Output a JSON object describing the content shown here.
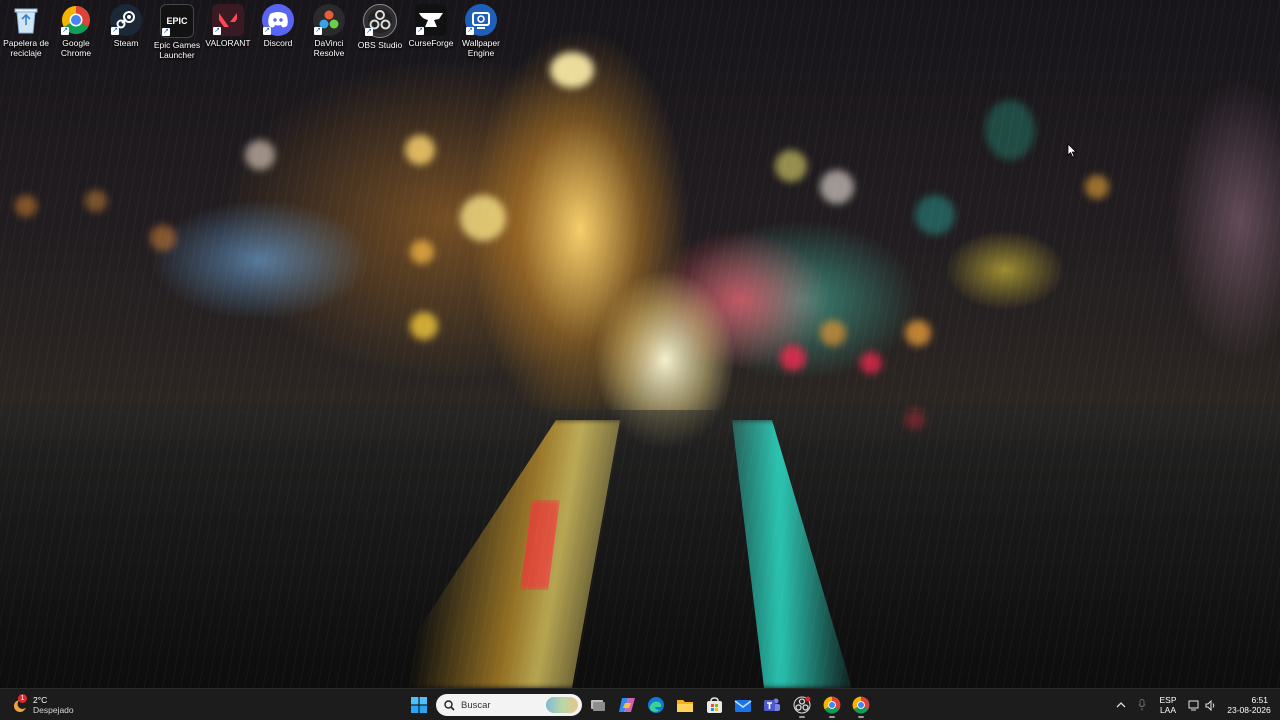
{
  "desktop": {
    "icons": [
      {
        "label": "Papelera de reciclaje",
        "icon": "recycle-bin-icon"
      },
      {
        "label": "Google Chrome",
        "icon": "chrome-icon"
      },
      {
        "label": "Steam",
        "icon": "steam-icon"
      },
      {
        "label": "Epic Games Launcher",
        "icon": "epic-games-icon",
        "glyph": "EPIC"
      },
      {
        "label": "VALORANT",
        "icon": "valorant-icon"
      },
      {
        "label": "Discord",
        "icon": "discord-icon"
      },
      {
        "label": "DaVinci Resolve",
        "icon": "davinci-resolve-icon"
      },
      {
        "label": "OBS Studio",
        "icon": "obs-studio-icon"
      },
      {
        "label": "CurseForge",
        "icon": "curseforge-icon"
      },
      {
        "label": "Wallpaper Engine",
        "icon": "wallpaper-engine-icon"
      }
    ]
  },
  "taskbar": {
    "weather": {
      "temp": "2°C",
      "condition": "Despejado",
      "badge": "1"
    },
    "search": {
      "placeholder": "Buscar"
    },
    "apps": [
      "start-icon",
      "task-view-icon",
      "copilot-icon",
      "edge-icon",
      "file-explorer-icon",
      "microsoft-store-icon",
      "mail-icon",
      "teams-icon",
      "obs-studio-icon",
      "chrome-icon",
      "chrome-icon"
    ],
    "tray": {
      "language": "ESP",
      "layout": "LAA",
      "time": "6:51",
      "date": "23-08-2026"
    }
  },
  "colors": {
    "taskbar_bg": "#1c1c1c",
    "accent": "#0078d4"
  }
}
